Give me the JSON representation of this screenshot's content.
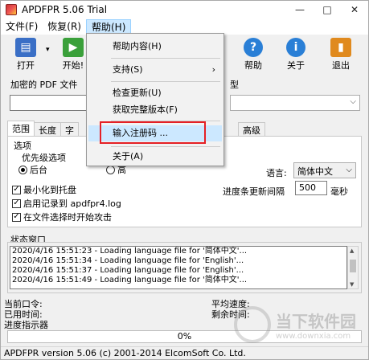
{
  "window": {
    "title": "APDFPR 5.06 Trial"
  },
  "title_buttons": [
    "—",
    "□",
    "✕"
  ],
  "menubar": [
    "文件(F)",
    "恢复(R)",
    "帮助(H)"
  ],
  "toolbar": {
    "open": "打开",
    "start": "开始!",
    "help": "帮助",
    "about": "关于",
    "exit": "退出"
  },
  "labels": {
    "encrypted_pdf": "加密的 PDF 文件",
    "attack_type": "型"
  },
  "tabs": [
    "范围",
    "长度",
    "字"
  ],
  "tab_advanced": "高级",
  "options": {
    "group_label": "选项",
    "priority_label": "优先级选项",
    "priority_background": "后台",
    "priority_high": "高",
    "minimize_tray": "最小化到托盘",
    "enable_log": "启用记录到 apdfpr4.log",
    "start_on_select": "在文件选择时开始攻击",
    "language_label": "语言:",
    "language_value": "简体中文",
    "interval_label": "进度条更新间隔",
    "interval_value": "500",
    "interval_unit": "毫秒"
  },
  "status": {
    "label": "状态窗口",
    "log": [
      "2020/4/16 15:51:23 - Loading language file for '简体中文'...",
      "2020/4/16 15:51:34 - Loading language file for 'English'...",
      "2020/4/16 15:51:37 - Loading language file for 'English'...",
      "2020/4/16 15:51:49 - Loading language file for '简体中文'..."
    ]
  },
  "stats": {
    "current_password": "当前口令:",
    "elapsed": "已用时间:",
    "progress_indicator": "进度指示器",
    "avg_speed": "平均速度:",
    "remaining": "剩余时间:"
  },
  "progress": {
    "percent": 0,
    "label": "0%"
  },
  "statusbar": "APDFPR version 5.06 (c) 2001-2014 ElcomSoft Co. Ltd.",
  "help_menu": {
    "items": [
      "帮助内容(H)",
      "支持(S)",
      "检查更新(U)",
      "获取完整版本(F)",
      "输入注册码 ...",
      "关于(A)"
    ]
  },
  "watermark": {
    "name": "当下软件园",
    "url": "www.downxia.com"
  },
  "colors": {
    "highlight": "#e52025",
    "menu_hover": "#cce8ff"
  }
}
